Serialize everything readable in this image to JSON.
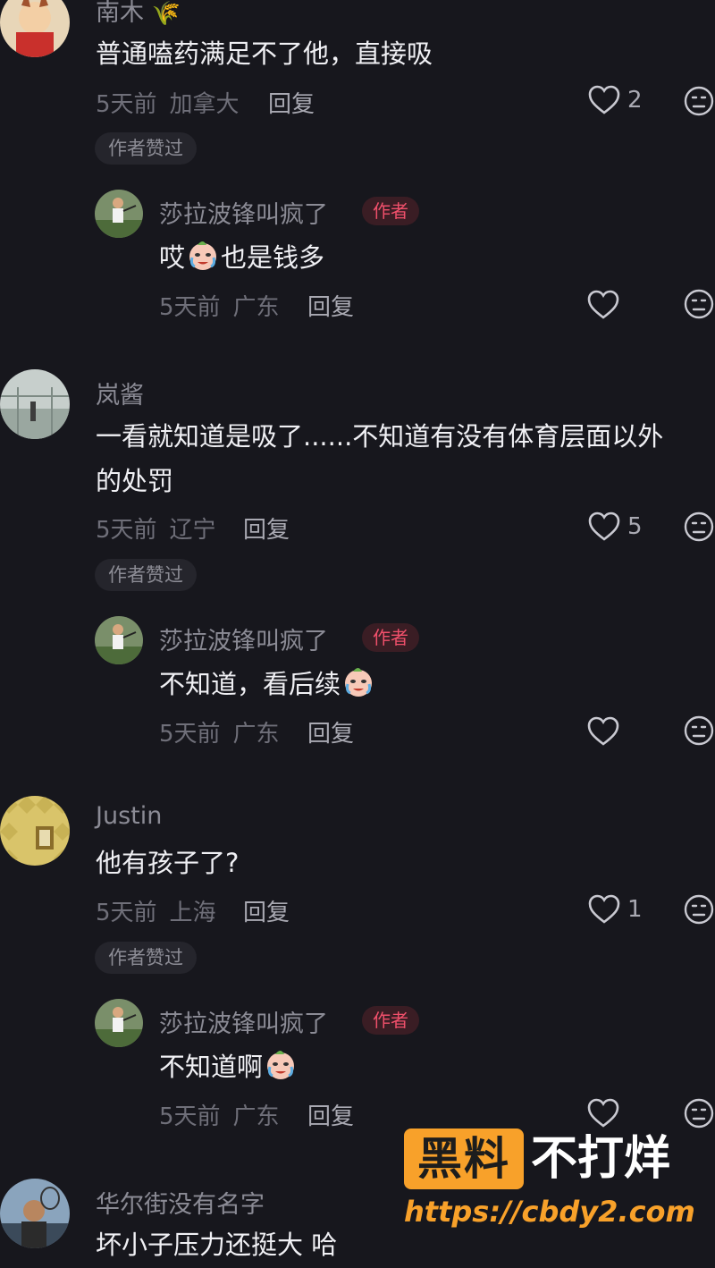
{
  "comments": [
    {
      "user": "南木",
      "text": "普通嗑药满足不了他，直接吸",
      "time": "5天前",
      "location": "加拿大",
      "reply_label": "回复",
      "likes": "2",
      "author_liked": "作者赞过",
      "reply": {
        "user": "莎拉波锋叫疯了",
        "tag": "作者",
        "text_before": "哎",
        "text_after": "也是钱多",
        "time": "5天前",
        "location": "广东",
        "reply_label": "回复"
      }
    },
    {
      "user": "岚酱",
      "text_line1": "一看就知道是吸了......不知道有没有体育层面以外",
      "text_line2": "的处罚",
      "time": "5天前",
      "location": "辽宁",
      "reply_label": "回复",
      "likes": "5",
      "author_liked": "作者赞过",
      "reply": {
        "user": "莎拉波锋叫疯了",
        "tag": "作者",
        "text_before": "不知道，看后续",
        "time": "5天前",
        "location": "广东",
        "reply_label": "回复"
      }
    },
    {
      "user": "Justin",
      "text": "他有孩子了?",
      "time": "5天前",
      "location": "上海",
      "reply_label": "回复",
      "likes": "1",
      "author_liked": "作者赞过",
      "reply": {
        "user": "莎拉波锋叫疯了",
        "tag": "作者",
        "text_before": "不知道啊",
        "time": "5天前",
        "location": "广东",
        "reply_label": "回复"
      }
    },
    {
      "user": "华尔街没有名字",
      "text": "坏小子压力还挺大 哈"
    }
  ],
  "watermark": {
    "box": "黑料",
    "text": "不打烊",
    "url": "https://cbdy2.com"
  },
  "colors": {
    "background": "#17171d",
    "author_tag": "#f0506b",
    "watermark": "#f8a12a"
  }
}
